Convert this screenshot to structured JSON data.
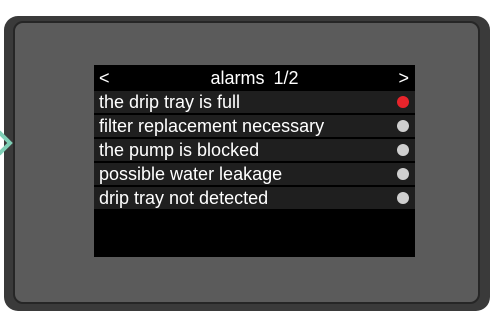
{
  "screen": {
    "title": "alarms",
    "page": "1/2",
    "prev_symbol": "<",
    "next_symbol": ">"
  },
  "colors": {
    "active_alarm": "#e8242b",
    "inactive_alarm": "#cfcfcf",
    "nav_arrow": "#7fcfb6"
  },
  "alarms": [
    {
      "label": "the drip tray is full",
      "status": "active"
    },
    {
      "label": "filter replacement necessary",
      "status": "inactive"
    },
    {
      "label": "the pump is blocked",
      "status": "inactive"
    },
    {
      "label": "possible water leakage",
      "status": "inactive"
    },
    {
      "label": "drip tray not detected",
      "status": "inactive"
    }
  ]
}
